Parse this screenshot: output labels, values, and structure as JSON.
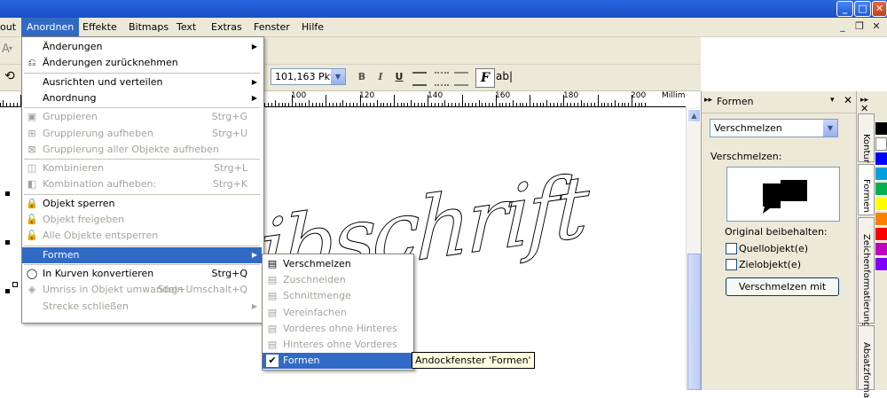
{
  "menubar": {
    "items": [
      "out",
      "Anordnen",
      "Effekte",
      "Bitmaps",
      "Text",
      "Extras",
      "Fenster",
      "Hilfe"
    ],
    "active": "Anordnen"
  },
  "toolbar": {
    "font_size": "101,163 Pkt",
    "format_buttons": [
      "B",
      "I",
      "U"
    ]
  },
  "ruler": {
    "labels": [
      "100",
      "120",
      "140",
      "160",
      "180",
      "200"
    ],
    "unit": "Millimeter"
  },
  "canvas": {
    "script_text": "ibschrift"
  },
  "anordnen_menu": {
    "items": [
      {
        "label": "Änderungen",
        "shortcut": "",
        "submenu": true,
        "disabled": false,
        "icon": ""
      },
      {
        "label": "Änderungen zurücknehmen",
        "shortcut": "",
        "submenu": false,
        "disabled": false,
        "icon": "undo-changes-icon"
      },
      {
        "sep": true
      },
      {
        "label": "Ausrichten und verteilen",
        "shortcut": "",
        "submenu": true,
        "disabled": false,
        "icon": ""
      },
      {
        "label": "Anordnung",
        "shortcut": "",
        "submenu": true,
        "disabled": false,
        "icon": ""
      },
      {
        "sep": true
      },
      {
        "label": "Gruppieren",
        "shortcut": "Strg+G",
        "submenu": false,
        "disabled": true,
        "icon": "group-icon"
      },
      {
        "label": "Gruppierung aufheben",
        "shortcut": "Strg+U",
        "submenu": false,
        "disabled": true,
        "icon": "ungroup-icon"
      },
      {
        "label": "Gruppierung aller Objekte aufheben",
        "shortcut": "",
        "submenu": false,
        "disabled": true,
        "icon": "ungroup-all-icon"
      },
      {
        "sep": true
      },
      {
        "label": "Kombinieren",
        "shortcut": "Strg+L",
        "submenu": false,
        "disabled": true,
        "icon": "combine-icon"
      },
      {
        "label": "Kombination aufheben:",
        "shortcut": "Strg+K",
        "submenu": false,
        "disabled": true,
        "icon": "break-apart-icon"
      },
      {
        "sep": true
      },
      {
        "label": "Objekt sperren",
        "shortcut": "",
        "submenu": false,
        "disabled": false,
        "icon": "lock-icon"
      },
      {
        "label": "Objekt freigeben",
        "shortcut": "",
        "submenu": false,
        "disabled": true,
        "icon": "unlock-icon"
      },
      {
        "label": "Alle Objekte entsperren",
        "shortcut": "",
        "submenu": false,
        "disabled": true,
        "icon": "unlock-all-icon"
      },
      {
        "sep": true
      },
      {
        "label": "Formen",
        "shortcut": "",
        "submenu": true,
        "disabled": false,
        "icon": "",
        "highlighted": true
      },
      {
        "sep": true
      },
      {
        "label": "In Kurven konvertieren",
        "shortcut": "Strg+Q",
        "submenu": false,
        "disabled": false,
        "icon": "convert-to-curves-icon"
      },
      {
        "label": "Umriss in Objekt umwandeln",
        "shortcut": "Strg+Umschalt+Q",
        "submenu": false,
        "disabled": true,
        "icon": "outline-to-object-icon"
      },
      {
        "label": "Strecke schließen",
        "shortcut": "",
        "submenu": true,
        "disabled": true,
        "icon": ""
      }
    ]
  },
  "formen_submenu": {
    "items": [
      {
        "label": "Verschmelzen",
        "disabled": false,
        "icon": "weld-icon"
      },
      {
        "label": "Zuschneiden",
        "disabled": true,
        "icon": "trim-icon"
      },
      {
        "label": "Schnittmenge",
        "disabled": true,
        "icon": "intersect-icon"
      },
      {
        "label": "Vereinfachen",
        "disabled": true,
        "icon": "simplify-icon"
      },
      {
        "label": "Vorderes ohne Hinteres",
        "disabled": true,
        "icon": "front-minus-back-icon"
      },
      {
        "label": "Hinteres ohne Vorderes",
        "disabled": true,
        "icon": "back-minus-front-icon"
      },
      {
        "label": "Formen",
        "disabled": false,
        "icon": "checkmark-icon",
        "highlighted": true
      }
    ],
    "tooltip": "Andockfenster 'Formen'"
  },
  "docker": {
    "title": "Formen",
    "mode": "Verschmelzen",
    "section_label": "Verschmelzen:",
    "keep_label": "Original beibehalten:",
    "checkbox_source": "Quellobjekt(e)",
    "checkbox_target": "Zielobjekt(e)",
    "apply_button": "Verschmelzen mit",
    "tabs": [
      "Kontur",
      "Formen",
      "Zeichenformatierung",
      "Absatzforma"
    ]
  },
  "palette": {
    "colors": [
      "#000000",
      "#ffffff",
      "#0000ff",
      "#00a0e0",
      "#00b050",
      "#ffff00",
      "#ff8000",
      "#ff0000",
      "#c000c0",
      "#8000ff"
    ]
  }
}
